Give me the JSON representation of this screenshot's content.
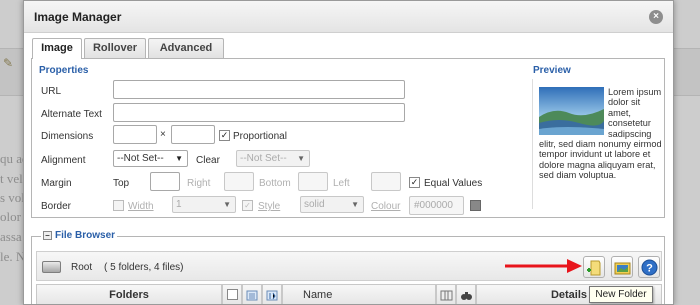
{
  "background": {
    "lines": [
      "qu aq",
      "t veli",
      "s vol",
      "olor s",
      "assa",
      "le. Ni"
    ]
  },
  "dialog": {
    "title": "Image Manager",
    "close_glyph": "×"
  },
  "tabs": [
    {
      "label": "Image",
      "active": true
    },
    {
      "label": "Rollover",
      "active": false
    },
    {
      "label": "Advanced",
      "active": false
    }
  ],
  "properties": {
    "section_title": "Properties",
    "url_label": "URL",
    "url_value": "",
    "alt_label": "Alternate Text",
    "alt_value": "",
    "dimensions_label": "Dimensions",
    "width_value": "",
    "times_glyph": "×",
    "height_value": "",
    "proportional_label": "Proportional",
    "proportional_checked": true,
    "alignment_label": "Alignment",
    "alignment_value": "--Not Set--",
    "clear_label": "Clear",
    "clear_value": "--Not Set--",
    "margin_label": "Margin",
    "margin_top_label": "Top",
    "margin_right_label": "Right",
    "margin_bottom_label": "Bottom",
    "margin_left_label": "Left",
    "equal_values_label": "Equal Values",
    "equal_values_checked": true,
    "border_label": "Border",
    "border_width_label": "Width",
    "border_width_value": "1",
    "border_style_label": "Style",
    "border_style_value": "solid",
    "border_colour_label": "Colour",
    "border_colour_value": "#000000"
  },
  "preview": {
    "title": "Preview",
    "text": "Lorem ipsum dolor sit amet, consetetur sadipscing elitr, sed diam nonumy eirmod tempor invidunt ut labore et dolore magna aliquyam erat, sed diam voluptua."
  },
  "file_browser": {
    "title": "File Browser",
    "root_label": "Root",
    "root_count": "( 5 folders, 4 files)",
    "folders_header": "Folders",
    "name_header": "Name",
    "details_header": "Details",
    "buttons": [
      {
        "name": "new-folder-icon"
      },
      {
        "name": "upload-icon"
      },
      {
        "name": "help-icon"
      }
    ]
  },
  "tooltip": {
    "text": "New Folder"
  },
  "colors": {
    "accent": "#2a5fa8",
    "annotation_arrow": "#e8141b"
  }
}
